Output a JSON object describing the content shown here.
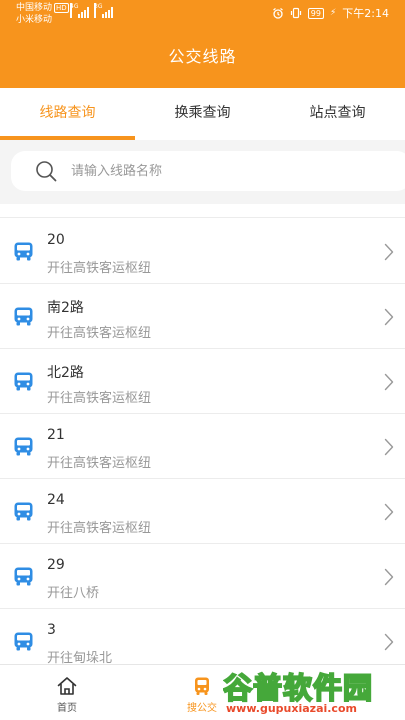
{
  "status_bar": {
    "carrier_primary": "中国移动",
    "carrier_hd": "HD",
    "carrier_secondary": "小米移动",
    "net_primary": "4G",
    "net_secondary": "3G",
    "battery": "99",
    "time": "下午2:14"
  },
  "header": {
    "title": "公交线路"
  },
  "tabs": [
    {
      "label": "线路查询",
      "active": true
    },
    {
      "label": "换乘查询",
      "active": false
    },
    {
      "label": "站点查询",
      "active": false
    }
  ],
  "search": {
    "placeholder": "请输入线路名称"
  },
  "routes": [
    {
      "name": "20",
      "destination": "开往高铁客运枢纽"
    },
    {
      "name": "南2路",
      "destination": "开往高铁客运枢纽"
    },
    {
      "name": "北2路",
      "destination": "开往高铁客运枢纽"
    },
    {
      "name": "21",
      "destination": "开往高铁客运枢纽"
    },
    {
      "name": "24",
      "destination": "开往高铁客运枢纽"
    },
    {
      "name": "29",
      "destination": "开往八桥"
    },
    {
      "name": "3",
      "destination": "开往甸垛北"
    }
  ],
  "bottom_nav": [
    {
      "label": "首页",
      "icon": "home-icon",
      "active": false
    },
    {
      "label": "搜公交",
      "icon": "bus-icon",
      "active": true
    }
  ],
  "watermark": {
    "text": "谷普软件园",
    "url": "www.gupuxiazai.com"
  },
  "colors": {
    "accent": "#f7941d",
    "bus_icon": "#2f8de4",
    "watermark_green": "#45a83a",
    "watermark_red": "#e94a2b"
  }
}
